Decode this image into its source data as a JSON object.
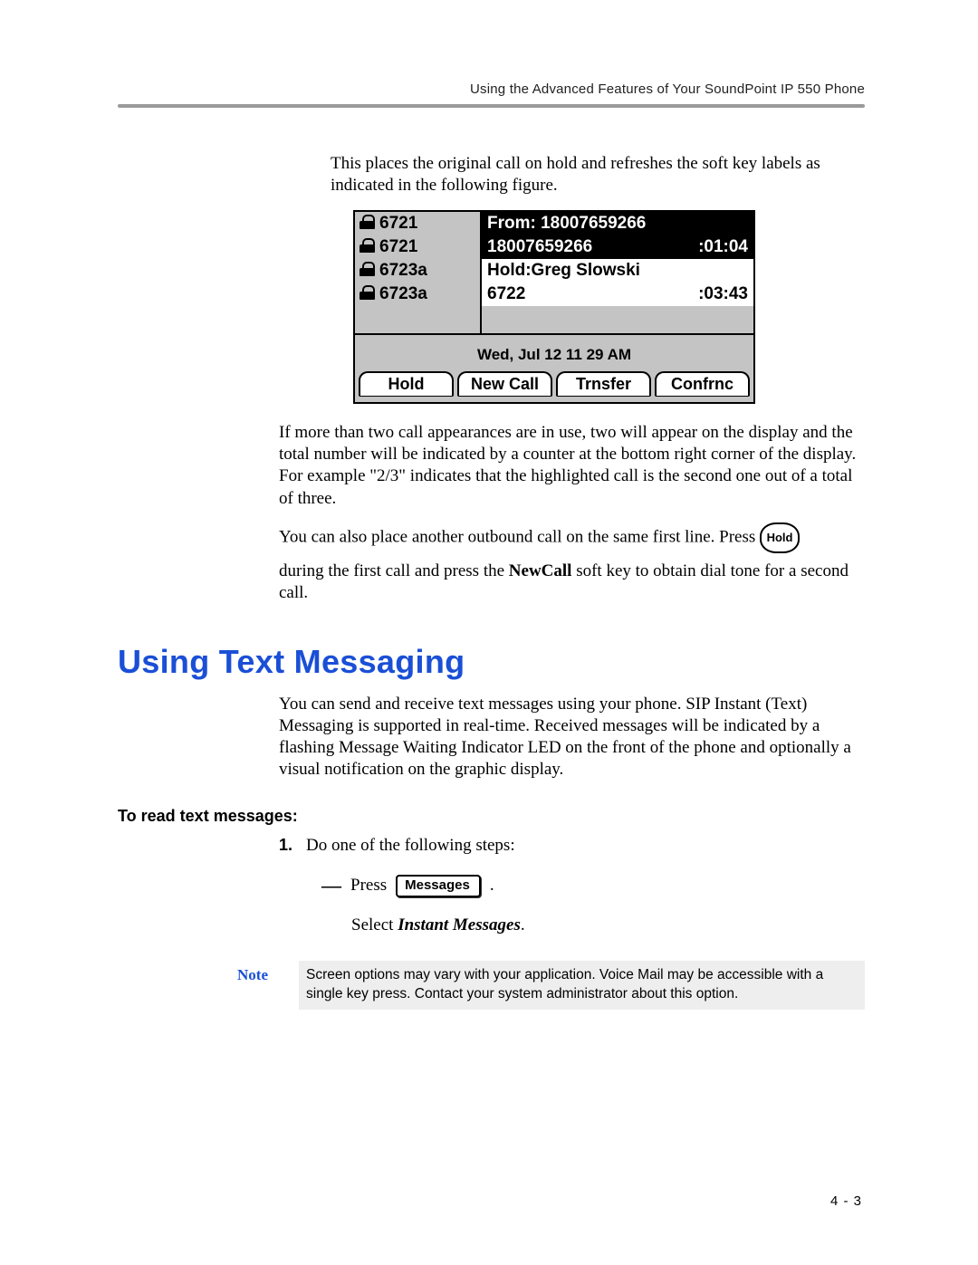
{
  "header": {
    "title": "Using the Advanced Features of Your SoundPoint IP 550 Phone"
  },
  "para1": "This places the original call on hold and refreshes the soft key labels as indicated in the following figure.",
  "phone": {
    "lines": [
      {
        "ext": "6721",
        "rightA": "From: 18007659266",
        "rightB": ""
      },
      {
        "ext": "6721",
        "rightA": "18007659266",
        "rightB": ":01:04"
      },
      {
        "ext": "6723a",
        "rightA": "Hold:Greg Slowski",
        "rightB": ""
      },
      {
        "ext": "6723a",
        "rightA": "6722",
        "rightB": ":03:43"
      }
    ],
    "datetime": "Wed, Jul 12  11 29 AM",
    "softkeys": [
      "Hold",
      "New Call",
      "Trnsfer",
      "Confrnc"
    ]
  },
  "para2": "If more than two call appearances are in use, two will appear on the display and the total number will be indicated by a counter at the bottom right corner of the display. For example \"2/3\" indicates that the highlighted call is the second one out of a total of three.",
  "para3a": "You can also place another outbound call on the same first line. Press ",
  "holdLabel": "Hold",
  "para3b_a": "during the first call and press the ",
  "para3b_bold": "NewCall",
  "para3b_b": " soft key to obtain dial tone for a second call.",
  "sectionTitle": "Using Text Messaging",
  "para4": "You can send and receive text messages using your phone. SIP Instant (Text) Messaging is supported in real-time. Received messages will be indicated by a flashing Message Waiting Indicator LED on the front of the phone and optionally a visual notification on the graphic display.",
  "subhead": "To read text messages:",
  "stepNum": "1.",
  "stepText": "Do one of the following steps:",
  "substepPress": "Press",
  "messagesKey": "Messages",
  "selectLine_a": "Select ",
  "selectLine_b": "Instant Messages",
  "selectLine_c": ".",
  "noteLabel": "Note",
  "noteBody": "Screen options may vary with your application. Voice Mail may be accessible with a single key press. Contact your system administrator about this option.",
  "pageNumber": "4 - 3"
}
